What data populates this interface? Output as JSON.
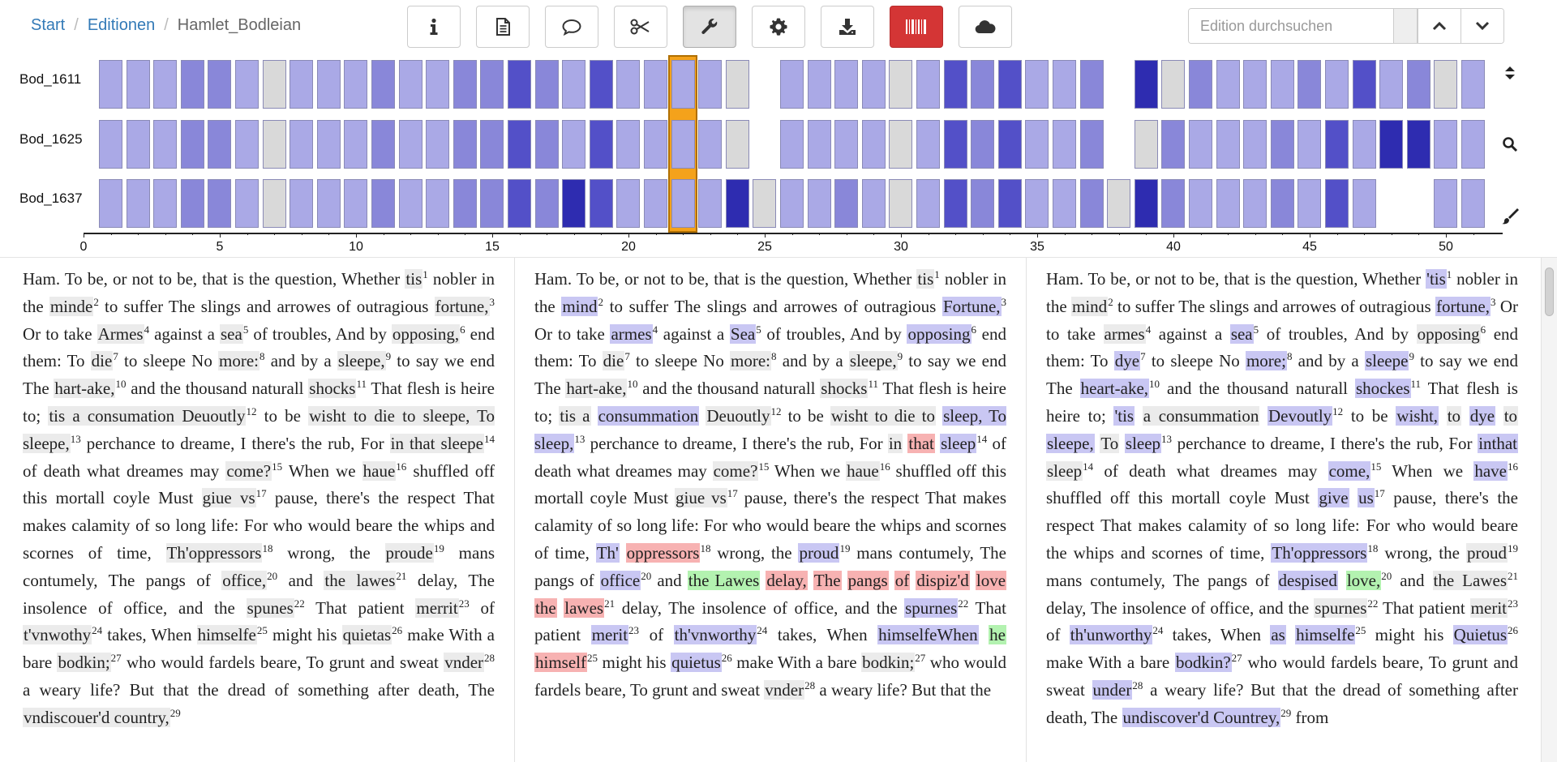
{
  "breadcrumb": {
    "start": "Start",
    "editions": "Editionen",
    "current": "Hamlet_Bodleian",
    "separator": "/"
  },
  "toolbar": {
    "buttons": [
      {
        "name": "info-icon",
        "state": "normal"
      },
      {
        "name": "document-icon",
        "state": "normal"
      },
      {
        "name": "comment-icon",
        "state": "normal"
      },
      {
        "name": "scissors-icon",
        "state": "normal"
      },
      {
        "name": "wrench-icon",
        "state": "active"
      },
      {
        "name": "gear-icon",
        "state": "normal"
      },
      {
        "name": "download-icon",
        "state": "normal"
      },
      {
        "name": "barcode-icon",
        "state": "red"
      },
      {
        "name": "cloud-icon",
        "state": "normal"
      }
    ]
  },
  "search": {
    "placeholder": "Edition durchsuchen",
    "prev_icon": "chevron-up-icon",
    "next_icon": "chevron-down-icon"
  },
  "overview": {
    "rows": [
      "Bod_1611",
      "Bod_1625",
      "Bod_1637"
    ],
    "axis_ticks": [
      "0",
      "5",
      "10",
      "15",
      "20",
      "25",
      "30",
      "35",
      "40",
      "45",
      "50"
    ],
    "selected_segment": 22,
    "side_icons": [
      "sort-icon",
      "search-icon",
      "brush-icon"
    ],
    "colors": {
      "light": "#aaa9e6",
      "mid": "#8987d9",
      "dark": "#5350c8",
      "darkest": "#2e2cb0",
      "none": "#d9d9d9",
      "highlight": "#f4a21b"
    }
  },
  "columns": [
    [
      {
        "t": "Ham. To be, or not to be, that is the question, Whether "
      },
      {
        "t": "tis",
        "c": "g",
        "n": "1"
      },
      {
        "t": " nobler in the "
      },
      {
        "t": "minde",
        "c": "g",
        "n": "2"
      },
      {
        "t": " to suffer The slings and arrowes of outragious "
      },
      {
        "t": "fortune,",
        "c": "g",
        "n": "3"
      },
      {
        "t": " Or to take "
      },
      {
        "t": "Armes",
        "c": "g",
        "n": "4"
      },
      {
        "t": " against a "
      },
      {
        "t": "sea",
        "c": "g",
        "n": "5"
      },
      {
        "t": " of troubles, And by "
      },
      {
        "t": "opposing,",
        "c": "g",
        "n": "6"
      },
      {
        "t": " end them: To "
      },
      {
        "t": "die",
        "c": "g",
        "n": "7"
      },
      {
        "t": " to sleepe No "
      },
      {
        "t": "more:",
        "c": "g",
        "n": "8"
      },
      {
        "t": " and by a "
      },
      {
        "t": "sleepe,",
        "c": "g",
        "n": "9"
      },
      {
        "t": " to say we end The "
      },
      {
        "t": "hart-ake,",
        "c": "g",
        "n": "10"
      },
      {
        "t": " and the thousand naturall "
      },
      {
        "t": "shocks",
        "c": "g",
        "n": "11"
      },
      {
        "t": " That flesh is heire to; "
      },
      {
        "t": "tis a consumation Deuoutly",
        "c": "g",
        "n": "12"
      },
      {
        "t": " to be "
      },
      {
        "t": "wisht to die to sleepe, To sleepe,",
        "c": "g",
        "n": "13"
      },
      {
        "t": " perchance to dreame, I there's the rub, For "
      },
      {
        "t": "in that sleepe",
        "c": "g",
        "n": "14"
      },
      {
        "t": " of death what dreames may "
      },
      {
        "t": "come?",
        "c": "g",
        "n": "15"
      },
      {
        "t": " When we "
      },
      {
        "t": "haue",
        "c": "g",
        "n": "16"
      },
      {
        "t": " shuffled off this mortall coyle Must "
      },
      {
        "t": "giue vs",
        "c": "g",
        "n": "17"
      },
      {
        "t": " pause, there's the respect That makes calamity of so long life: For who would beare the whips and scornes of time, "
      },
      {
        "t": "Th'oppressors",
        "c": "g",
        "n": "18"
      },
      {
        "t": " wrong, the "
      },
      {
        "t": "proude",
        "c": "g",
        "n": "19"
      },
      {
        "t": " mans contumely, The pangs of "
      },
      {
        "t": "office,",
        "c": "g",
        "n": "20"
      },
      {
        "t": " and "
      },
      {
        "t": "the lawes",
        "c": "g",
        "n": "21"
      },
      {
        "t": " delay, The insolence of office, and the "
      },
      {
        "t": "spunes",
        "c": "g",
        "n": "22"
      },
      {
        "t": " That patient "
      },
      {
        "t": "merrit",
        "c": "g",
        "n": "23"
      },
      {
        "t": " of "
      },
      {
        "t": "t'vnwothy",
        "c": "g",
        "n": "24"
      },
      {
        "t": " takes, When "
      },
      {
        "t": "himselfe",
        "c": "g",
        "n": "25"
      },
      {
        "t": " might his "
      },
      {
        "t": "quietas",
        "c": "g",
        "n": "26"
      },
      {
        "t": " make With a bare "
      },
      {
        "t": "bodkin;",
        "c": "g",
        "n": "27"
      },
      {
        "t": " who would fardels beare, To grunt and sweat "
      },
      {
        "t": "vnder",
        "c": "g",
        "n": "28"
      },
      {
        "t": " a weary life? But that the dread of something after death, The "
      },
      {
        "t": "vndiscouer'd country,",
        "c": "g",
        "n": "29"
      }
    ],
    [
      {
        "t": "Ham. To be, or not to be, that is the question, Whether "
      },
      {
        "t": "tis",
        "c": "g",
        "n": "1"
      },
      {
        "t": " nobler in the "
      },
      {
        "t": "mind",
        "c": "b",
        "n": "2"
      },
      {
        "t": " to suffer The slings and arrowes of outragious "
      },
      {
        "t": "Fortune,",
        "c": "b",
        "n": "3"
      },
      {
        "t": " Or to take "
      },
      {
        "t": "armes",
        "c": "b",
        "n": "4"
      },
      {
        "t": " against a "
      },
      {
        "t": "Sea",
        "c": "b",
        "n": "5"
      },
      {
        "t": " of troubles, And by "
      },
      {
        "t": "opposing",
        "c": "b",
        "n": "6"
      },
      {
        "t": " end them: To "
      },
      {
        "t": "die",
        "c": "g",
        "n": "7"
      },
      {
        "t": " to sleepe No "
      },
      {
        "t": "more:",
        "c": "g",
        "n": "8"
      },
      {
        "t": " and by a "
      },
      {
        "t": "sleepe,",
        "c": "g",
        "n": "9"
      },
      {
        "t": " to say we end The "
      },
      {
        "t": "hart-ake,",
        "c": "g",
        "n": "10"
      },
      {
        "t": " and the thousand naturall "
      },
      {
        "t": "shocks",
        "c": "g",
        "n": "11"
      },
      {
        "t": " That flesh is heire to; "
      },
      {
        "t": "tis a",
        "c": "g"
      },
      {
        "t": " "
      },
      {
        "t": "consummation",
        "c": "b"
      },
      {
        "t": " "
      },
      {
        "t": "Deuoutly",
        "c": "g",
        "n": "12"
      },
      {
        "t": " to be "
      },
      {
        "t": "wisht to die to",
        "c": "g"
      },
      {
        "t": " "
      },
      {
        "t": "sleep, To sleep,",
        "c": "b",
        "n": "13"
      },
      {
        "t": " perchance to dreame, I there's the rub, For "
      },
      {
        "t": "in",
        "c": "g"
      },
      {
        "t": " "
      },
      {
        "t": "that",
        "c": "r"
      },
      {
        "t": " "
      },
      {
        "t": "sleep",
        "c": "b",
        "n": "14"
      },
      {
        "t": " of death what dreames may "
      },
      {
        "t": "come?",
        "c": "g",
        "n": "15"
      },
      {
        "t": " When we "
      },
      {
        "t": "haue",
        "c": "g",
        "n": "16"
      },
      {
        "t": " shuffled off this mortall coyle Must "
      },
      {
        "t": "giue vs",
        "c": "g",
        "n": "17"
      },
      {
        "t": " pause, there's the respect That makes calamity of so long life: For who would beare the whips and scornes of time, "
      },
      {
        "t": "Th'",
        "c": "b"
      },
      {
        "t": " "
      },
      {
        "t": "oppressors",
        "c": "r",
        "n": "18"
      },
      {
        "t": " wrong, the "
      },
      {
        "t": "proud",
        "c": "b",
        "n": "19"
      },
      {
        "t": " mans contumely, The pangs of "
      },
      {
        "t": "office",
        "c": "b",
        "n": "20"
      },
      {
        "t": " and "
      },
      {
        "t": "the Lawes",
        "c": "gr"
      },
      {
        "t": " "
      },
      {
        "t": "delay,",
        "c": "r"
      },
      {
        "t": " "
      },
      {
        "t": "The",
        "c": "r"
      },
      {
        "t": " "
      },
      {
        "t": "pangs",
        "c": "r"
      },
      {
        "t": " "
      },
      {
        "t": "of",
        "c": "r"
      },
      {
        "t": " "
      },
      {
        "t": "dispiz'd",
        "c": "r"
      },
      {
        "t": " "
      },
      {
        "t": "love",
        "c": "r"
      },
      {
        "t": " "
      },
      {
        "t": "the",
        "c": "r"
      },
      {
        "t": " "
      },
      {
        "t": "lawes",
        "c": "r",
        "n": "21"
      },
      {
        "t": " delay, The insolence of office, and the "
      },
      {
        "t": "spurnes",
        "c": "b",
        "n": "22"
      },
      {
        "t": " That patient "
      },
      {
        "t": "merit",
        "c": "b",
        "n": "23"
      },
      {
        "t": " of "
      },
      {
        "t": "th'vnworthy",
        "c": "b",
        "n": "24"
      },
      {
        "t": " takes, When "
      },
      {
        "t": "himselfeWhen",
        "c": "b"
      },
      {
        "t": " "
      },
      {
        "t": "he",
        "c": "gr"
      },
      {
        "t": " "
      },
      {
        "t": "himself",
        "c": "r",
        "n": "25"
      },
      {
        "t": " might his "
      },
      {
        "t": "quietus",
        "c": "b",
        "n": "26"
      },
      {
        "t": " make With a bare "
      },
      {
        "t": "bodkin;",
        "c": "g",
        "n": "27"
      },
      {
        "t": " who would fardels beare, To grunt and sweat "
      },
      {
        "t": "vnder",
        "c": "g",
        "n": "28"
      },
      {
        "t": " a weary life? But that the"
      }
    ],
    [
      {
        "t": "Ham. To be, or not to be, that is the question, Whether "
      },
      {
        "t": "'tis",
        "c": "b",
        "n": "1"
      },
      {
        "t": " nobler in the "
      },
      {
        "t": "mind",
        "c": "g",
        "n": "2"
      },
      {
        "t": " to suffer The slings and arrowes of outragious "
      },
      {
        "t": "fortune,",
        "c": "b",
        "n": "3"
      },
      {
        "t": " Or to take "
      },
      {
        "t": "armes",
        "c": "g",
        "n": "4"
      },
      {
        "t": " against a "
      },
      {
        "t": "sea",
        "c": "b",
        "n": "5"
      },
      {
        "t": " of troubles, And by "
      },
      {
        "t": "opposing",
        "c": "g",
        "n": "6"
      },
      {
        "t": " end them: To "
      },
      {
        "t": "dye",
        "c": "b",
        "n": "7"
      },
      {
        "t": " to sleepe No "
      },
      {
        "t": "more;",
        "c": "b",
        "n": "8"
      },
      {
        "t": " and by a "
      },
      {
        "t": "sleepe",
        "c": "b",
        "n": "9"
      },
      {
        "t": " to say we end The "
      },
      {
        "t": "heart-ake,",
        "c": "b",
        "n": "10"
      },
      {
        "t": " and the thousand naturall "
      },
      {
        "t": "shockes",
        "c": "b",
        "n": "11"
      },
      {
        "t": " That flesh is heire to; "
      },
      {
        "t": "'tis",
        "c": "b"
      },
      {
        "t": " "
      },
      {
        "t": "a consummation",
        "c": "g"
      },
      {
        "t": " "
      },
      {
        "t": "Devoutly",
        "c": "b",
        "n": "12"
      },
      {
        "t": " to be "
      },
      {
        "t": "wisht,",
        "c": "b"
      },
      {
        "t": " "
      },
      {
        "t": "to",
        "c": "g"
      },
      {
        "t": " "
      },
      {
        "t": "dye",
        "c": "b"
      },
      {
        "t": " "
      },
      {
        "t": "to",
        "c": "g"
      },
      {
        "t": " "
      },
      {
        "t": "sleepe,",
        "c": "b"
      },
      {
        "t": " "
      },
      {
        "t": "To",
        "c": "g"
      },
      {
        "t": " "
      },
      {
        "t": "sleep",
        "c": "b",
        "n": "13"
      },
      {
        "t": " perchance to dreame, I there's the rub, For "
      },
      {
        "t": "inthat",
        "c": "b"
      },
      {
        "t": " "
      },
      {
        "t": "sleep",
        "c": "g",
        "n": "14"
      },
      {
        "t": " of death what dreames may "
      },
      {
        "t": "come,",
        "c": "b",
        "n": "15"
      },
      {
        "t": " When we "
      },
      {
        "t": "have",
        "c": "b",
        "n": "16"
      },
      {
        "t": " shuffled off this mortall coyle Must "
      },
      {
        "t": "give",
        "c": "b"
      },
      {
        "t": " "
      },
      {
        "t": "us",
        "c": "b",
        "n": "17"
      },
      {
        "t": " pause, there's the respect That makes calamity of so long life: For who would beare the whips and scornes of time, "
      },
      {
        "t": "Th'oppressors",
        "c": "b",
        "n": "18"
      },
      {
        "t": " wrong, the "
      },
      {
        "t": "proud",
        "c": "g",
        "n": "19"
      },
      {
        "t": " mans contumely, The pangs of "
      },
      {
        "t": "despised",
        "c": "b"
      },
      {
        "t": " "
      },
      {
        "t": "love,",
        "c": "gr",
        "n": "20"
      },
      {
        "t": " and "
      },
      {
        "t": "the Lawes",
        "c": "g",
        "n": "21"
      },
      {
        "t": " delay, The insolence of office, and the "
      },
      {
        "t": "spurnes",
        "c": "g",
        "n": "22"
      },
      {
        "t": " That patient "
      },
      {
        "t": "merit",
        "c": "g",
        "n": "23"
      },
      {
        "t": " of "
      },
      {
        "t": "th'unworthy",
        "c": "b",
        "n": "24"
      },
      {
        "t": " takes, When "
      },
      {
        "t": "as",
        "c": "b"
      },
      {
        "t": " "
      },
      {
        "t": "himselfe",
        "c": "b",
        "n": "25"
      },
      {
        "t": " might his "
      },
      {
        "t": "Quietus",
        "c": "b",
        "n": "26"
      },
      {
        "t": " make With a bare "
      },
      {
        "t": "bodkin?",
        "c": "b",
        "n": "27"
      },
      {
        "t": " who would fardels beare, To grunt and sweat "
      },
      {
        "t": "under",
        "c": "b",
        "n": "28"
      },
      {
        "t": " a weary life? But that the dread of something after death, The "
      },
      {
        "t": "undiscover'd Countrey,",
        "c": "b",
        "n": "29"
      },
      {
        "t": " from"
      }
    ]
  ]
}
